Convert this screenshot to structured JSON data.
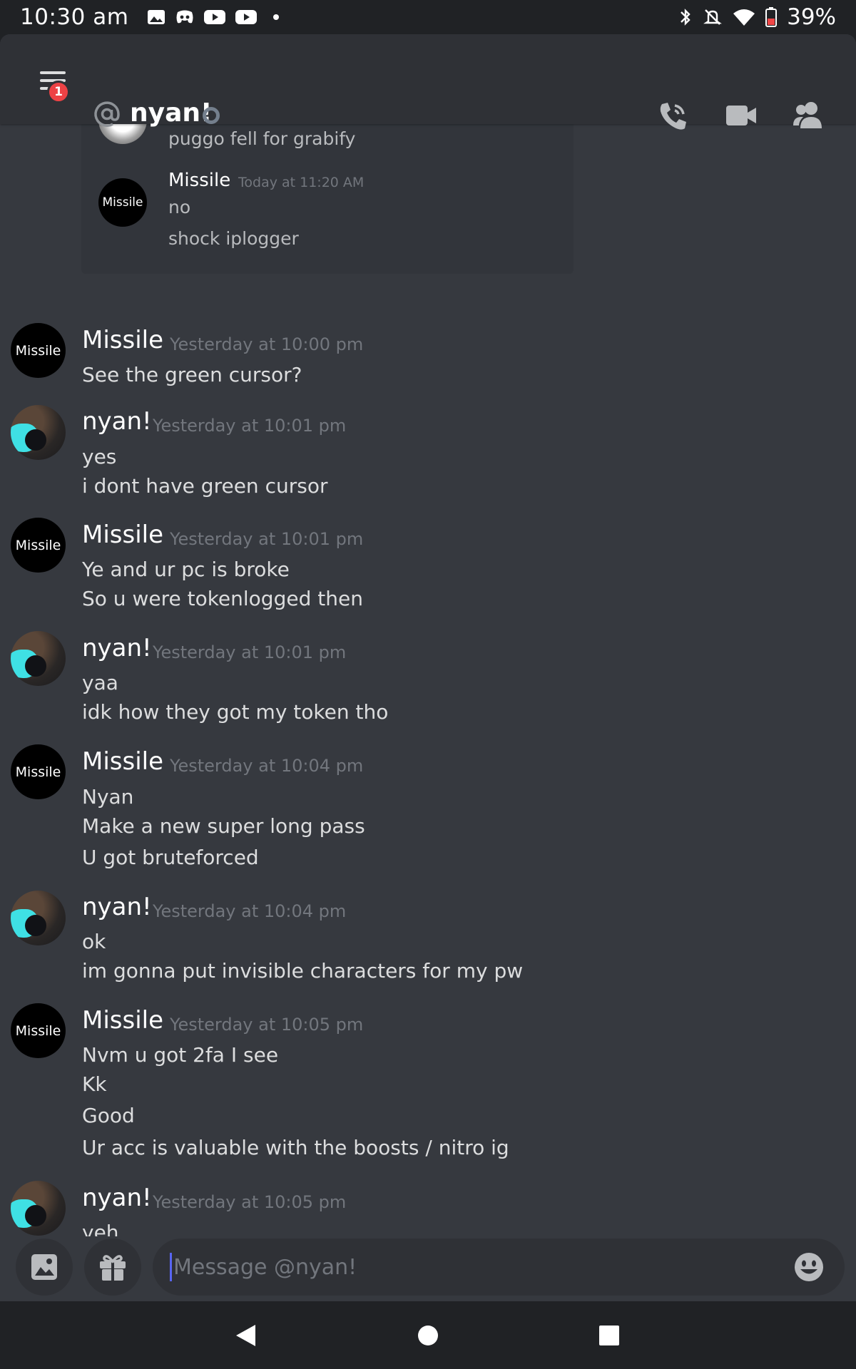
{
  "status_bar": {
    "time": "10:30 am",
    "battery": "39%",
    "icons": [
      "gallery-icon",
      "discord-icon",
      "youtube-icon",
      "youtube-icon",
      "dot-icon",
      "bluetooth-icon",
      "mute-icon",
      "wifi-icon",
      "battery-icon"
    ]
  },
  "header": {
    "title": "nyan!",
    "menu_badge": "1",
    "actions": [
      "call-icon",
      "video-icon",
      "members-icon"
    ]
  },
  "embed": {
    "partial_text": "puggo fell for grabify",
    "author": "Missile",
    "author_avatar_text": "Missile",
    "timestamp": "Today at 11:20 AM",
    "lines": [
      "no",
      "shock iplogger"
    ]
  },
  "messages": [
    {
      "author": "Missile",
      "avatar_text": "Missile",
      "timestamp": "Yesterday at 10:00 pm",
      "lines": [
        "See the green cursor?"
      ]
    },
    {
      "author": "nyan!",
      "timestamp": "Yesterday at 10:01 pm",
      "lines": [
        "yes",
        "i dont have green cursor"
      ]
    },
    {
      "author": "Missile",
      "avatar_text": "Missile",
      "timestamp": "Yesterday at 10:01 pm",
      "lines": [
        "Ye and ur pc is broke",
        "So u were tokenlogged then"
      ]
    },
    {
      "author": "nyan!",
      "timestamp": "Yesterday at 10:01 pm",
      "lines": [
        "yaa",
        "idk how they got my token tho"
      ]
    },
    {
      "author": "Missile",
      "avatar_text": "Missile",
      "timestamp": "Yesterday at 10:04 pm",
      "lines": [
        "Nyan",
        "Make a new super long pass",
        "U got bruteforced"
      ]
    },
    {
      "author": "nyan!",
      "timestamp": "Yesterday at 10:04 pm",
      "lines": [
        "ok",
        "im gonna put invisible characters for my pw"
      ]
    },
    {
      "author": "Missile",
      "avatar_text": "Missile",
      "timestamp": "Yesterday at 10:05 pm",
      "lines": [
        "Nvm u got 2fa I see",
        "Kk",
        "Good",
        "Ur acc is valuable with the boosts / nitro ig"
      ]
    },
    {
      "author": "nyan!",
      "timestamp": "Yesterday at 10:05 pm",
      "lines": [
        "yeh"
      ]
    }
  ],
  "composer": {
    "placeholder": "Message @nyan!"
  },
  "colors": {
    "background": "#36393f",
    "header": "#2f3136",
    "accent": "#5865f2",
    "badge": "#ed4245"
  }
}
